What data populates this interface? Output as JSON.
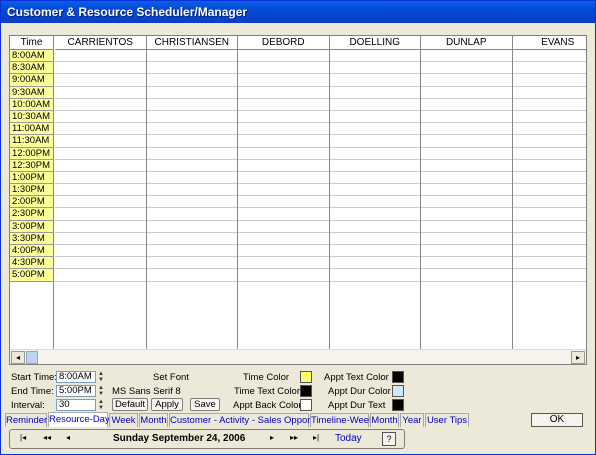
{
  "window": {
    "title": "Customer & Resource Scheduler/Manager"
  },
  "grid": {
    "time_header": "Time",
    "resources": [
      "CARRIENTOS",
      "CHRISTIANSEN",
      "DEBORD",
      "DOELLING",
      "DUNLAP",
      "EVANS"
    ],
    "times": [
      "8:00AM",
      "8:30AM",
      "9:00AM",
      "9:30AM",
      "10:00AM",
      "10:30AM",
      "11:00AM",
      "11:30AM",
      "12:00PM",
      "12:30PM",
      "1:00PM",
      "1:30PM",
      "2:00PM",
      "2:30PM",
      "3:00PM",
      "3:30PM",
      "4:00PM",
      "4:30PM",
      "5:00PM"
    ],
    "scroll_left": "◂",
    "scroll_right": "▸"
  },
  "settings": {
    "start_time_label": "Start Time:",
    "start_time_value": "8:00AM",
    "end_time_label": "End Time:",
    "end_time_value": "5:00PM",
    "interval_label": "Interval:",
    "interval_value": "30",
    "set_font_label": "Set Font",
    "font_value": "MS Sans Serif  8",
    "default_label": "Default",
    "apply_label": "Apply",
    "save_label": "Save",
    "time_color_label": "Time Color",
    "time_text_color_label": "Time Text Color",
    "appt_back_color_label": "Appt Back Color",
    "appt_text_color_label": "Appt Text Color",
    "appt_dur_color_label": "Appt Dur Color",
    "appt_dur_text_label": "Appt Dur Text",
    "colors": {
      "time_color": "#ffff66",
      "time_text_color": "#000000",
      "appt_back_color": "#ffffff",
      "appt_text_color": "#000000",
      "appt_dur_color": "#c8e8ff",
      "appt_dur_text": "#000000"
    }
  },
  "tabs": [
    "Reminder",
    "Resource-Day",
    "Week",
    "Month",
    "Customer - Activity - Sales Opportunity",
    "Timeline-Week",
    "Month",
    "Year",
    "User Tips"
  ],
  "active_tab": "Resource-Day",
  "ok_label": "OK",
  "nav": {
    "first": "|◂",
    "prev_fast": "◂◂",
    "prev": "◂",
    "date": "Sunday September 24, 2006",
    "next": "▸",
    "next_fast": "▸▸",
    "last": "▸|",
    "today": "Today",
    "help": "?"
  }
}
